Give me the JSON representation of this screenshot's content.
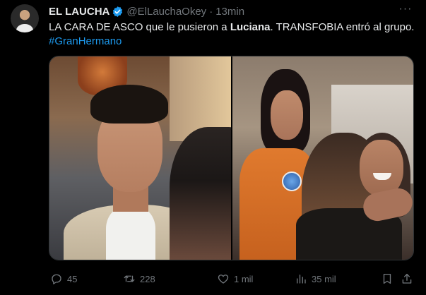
{
  "tweet": {
    "author_name": "EL LAUCHA",
    "handle": "@ElLauchaOkey",
    "separator": "·",
    "time": "13min",
    "more_label": "···",
    "text_part1": "LA CARA DE ASCO que le pusieron a ",
    "text_bold": "Luciana",
    "text_part2": ". TRANSFOBIA entró al grupo.",
    "hashtag": "#GranHermano"
  },
  "actions": {
    "reply_count": "45",
    "retweet_count": "228",
    "like_count": "1 mil",
    "views_count": "35 mil"
  },
  "colors": {
    "background": "#000000",
    "text": "#e7e9ea",
    "muted": "#71767b",
    "accent": "#1d9bf0"
  },
  "icons": [
    "verified-badge-icon",
    "more-icon",
    "reply-icon",
    "retweet-icon",
    "like-icon",
    "views-icon",
    "bookmark-icon",
    "share-icon"
  ]
}
